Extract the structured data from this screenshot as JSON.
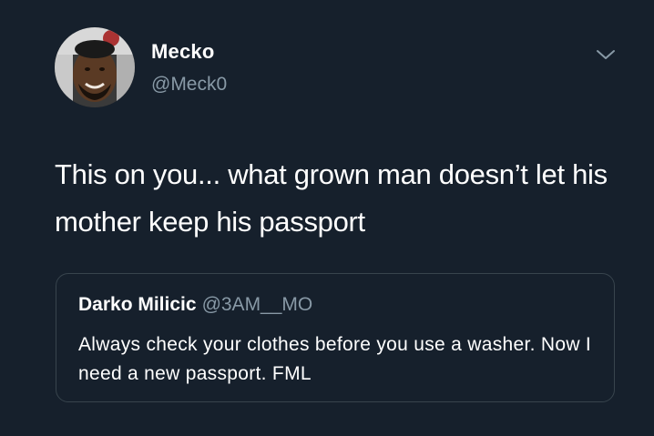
{
  "tweet": {
    "author": {
      "name": "Mecko",
      "handle": "@Meck0"
    },
    "text": "This on you... what grown man doesn’t let his mother keep his passport",
    "menu_icon": "chevron-down-icon"
  },
  "quoted_tweet": {
    "author_name": "Darko Milicic",
    "author_handle": "@3AM__MO",
    "text": "Always check your clothes before you use a washer. Now I need a new passport. FML"
  },
  "colors": {
    "background": "#16202c",
    "secondary_text": "#8899a6",
    "border": "#38444d"
  }
}
